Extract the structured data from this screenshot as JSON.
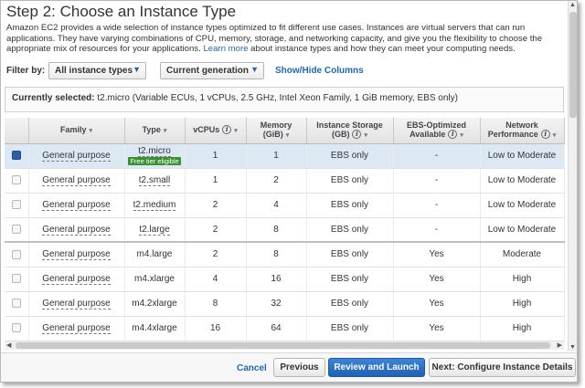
{
  "page": {
    "title": "Step 2: Choose an Instance Type",
    "description_before": "Amazon EC2 provides a wide selection of instance types optimized to fit different use cases. Instances are virtual servers that can run applications. They have varying combinations of CPU, memory, storage, and networking capacity, and give you the flexibility to choose the appropriate mix of resources for your applications.",
    "learn_more": "Learn more",
    "description_after": "about instance types and how they can meet your computing needs."
  },
  "filters": {
    "label": "Filter by:",
    "instance_types": "All instance types",
    "generation": "Current generation",
    "show_hide": "Show/Hide Columns"
  },
  "selection": {
    "label": "Currently selected:",
    "value": "t2.micro (Variable ECUs, 1 vCPUs, 2.5 GHz, Intel Xeon Family, 1 GiB memory, EBS only)"
  },
  "table": {
    "headers": {
      "family": "Family",
      "type": "Type",
      "vcpus": "vCPUs",
      "memory_line1": "Memory",
      "memory_line2": "(GiB)",
      "storage_line1": "Instance Storage",
      "storage_line2": "(GB)",
      "ebs_line1": "EBS-Optimized",
      "ebs_line2": "Available",
      "network_line1": "Network",
      "network_line2": "Performance"
    },
    "free_tier_label": "Free tier eligible",
    "rows": [
      {
        "family": "General purpose",
        "type": "t2.micro",
        "vcpus": "1",
        "memory": "1",
        "storage": "EBS only",
        "ebs": "-",
        "network": "Low to Moderate"
      },
      {
        "family": "General purpose",
        "type": "t2.small",
        "vcpus": "1",
        "memory": "2",
        "storage": "EBS only",
        "ebs": "-",
        "network": "Low to Moderate"
      },
      {
        "family": "General purpose",
        "type": "t2.medium",
        "vcpus": "2",
        "memory": "4",
        "storage": "EBS only",
        "ebs": "-",
        "network": "Low to Moderate"
      },
      {
        "family": "General purpose",
        "type": "t2.large",
        "vcpus": "2",
        "memory": "8",
        "storage": "EBS only",
        "ebs": "-",
        "network": "Low to Moderate"
      },
      {
        "family": "General purpose",
        "type": "m4.large",
        "vcpus": "2",
        "memory": "8",
        "storage": "EBS only",
        "ebs": "Yes",
        "network": "Moderate"
      },
      {
        "family": "General purpose",
        "type": "m4.xlarge",
        "vcpus": "4",
        "memory": "16",
        "storage": "EBS only",
        "ebs": "Yes",
        "network": "High"
      },
      {
        "family": "General purpose",
        "type": "m4.2xlarge",
        "vcpus": "8",
        "memory": "32",
        "storage": "EBS only",
        "ebs": "Yes",
        "network": "High"
      },
      {
        "family": "General purpose",
        "type": "m4.4xlarge",
        "vcpus": "16",
        "memory": "64",
        "storage": "EBS only",
        "ebs": "Yes",
        "network": "High"
      }
    ]
  },
  "footer": {
    "cancel": "Cancel",
    "previous": "Previous",
    "review_launch": "Review and Launch",
    "next": "Next: Configure Instance Details"
  },
  "colors": {
    "link": "#1f66b3",
    "primary_button": "#1f61b5",
    "free_tier_badge": "#3c8f2f",
    "selected_row": "#dde8f5"
  }
}
